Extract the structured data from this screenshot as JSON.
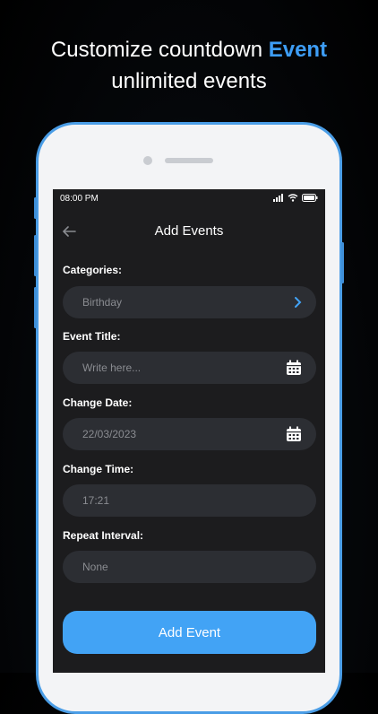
{
  "headline": {
    "line1_prefix": "Customize countdown ",
    "line1_accent": "Event",
    "line2": "unlimited events"
  },
  "status_bar": {
    "time": "08:00 PM"
  },
  "header": {
    "title": "Add Events"
  },
  "form": {
    "categories": {
      "label": "Categories:",
      "value": "Birthday"
    },
    "event_title": {
      "label": "Event Title:",
      "placeholder": "Write here..."
    },
    "change_date": {
      "label": "Change Date:",
      "value": "22/03/2023"
    },
    "change_time": {
      "label": "Change Time:",
      "value": "17:21"
    },
    "repeat_interval": {
      "label": "Repeat Interval:",
      "value": "None"
    }
  },
  "actions": {
    "submit_label": "Add Event"
  },
  "colors": {
    "accent": "#42a3f5",
    "screen_bg": "#1c1c1e",
    "field_bg": "#2c2e33"
  }
}
